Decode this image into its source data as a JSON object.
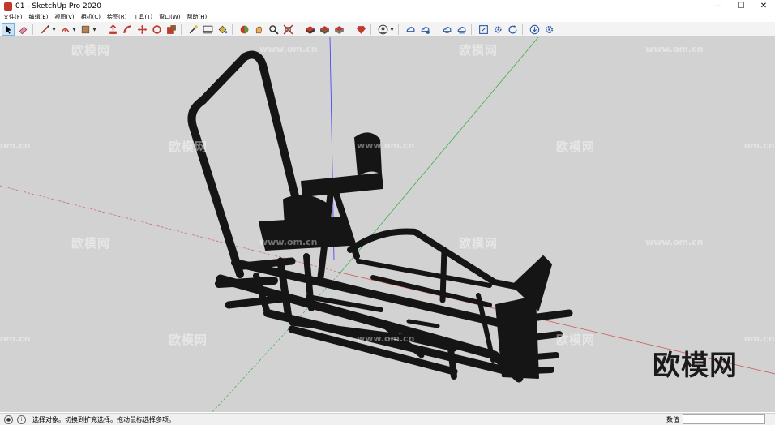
{
  "window": {
    "title": "01 - SketchUp Pro 2020"
  },
  "window_controls": {
    "minimize": "—",
    "maximize": "☐",
    "close": "✕"
  },
  "menu": [
    "文件(F)",
    "编辑(E)",
    "视图(V)",
    "相机(C)",
    "绘图(R)",
    "工具(T)",
    "窗口(W)",
    "帮助(H)"
  ],
  "toolbar": {
    "tools": [
      "select-icon",
      "eraser-icon",
      "pencil-line-icon",
      "arc-icon",
      "rectangle-icon",
      "push-pull-icon",
      "follow-me-icon",
      "move-icon",
      "rotate-icon",
      "scale-icon",
      "offset-icon",
      "tape-measure-icon",
      "dimension-icon",
      "paint-bucket-icon",
      "orbit-icon",
      "pan-icon",
      "zoom-icon",
      "zoom-extents-icon",
      "components-icon",
      "3d-warehouse-icon",
      "extension-warehouse-icon",
      "ruby-icon",
      "user-icon",
      "cloud-icon",
      "cloud-upload-icon",
      "cloud-sync-icon",
      "cloud-share-icon",
      "section-icon",
      "settings-icon",
      "refresh-icon",
      "download-icon",
      "gear-icon"
    ]
  },
  "watermarks": {
    "brand_small": "欧模网",
    "url": "www.om.cn",
    "url_partial": "om.cn",
    "brand_large": "欧模网"
  },
  "status": {
    "message": "选择对象。切换到扩充选择。拖动鼠标选择多项。",
    "measurements_label": "数值",
    "measurements_value": ""
  },
  "colors": {
    "viewport_bg": "#d2d2d2",
    "axis_red": "#d05050",
    "axis_green": "#3cb04a",
    "axis_blue": "#3a3aff",
    "model": "#151515"
  }
}
